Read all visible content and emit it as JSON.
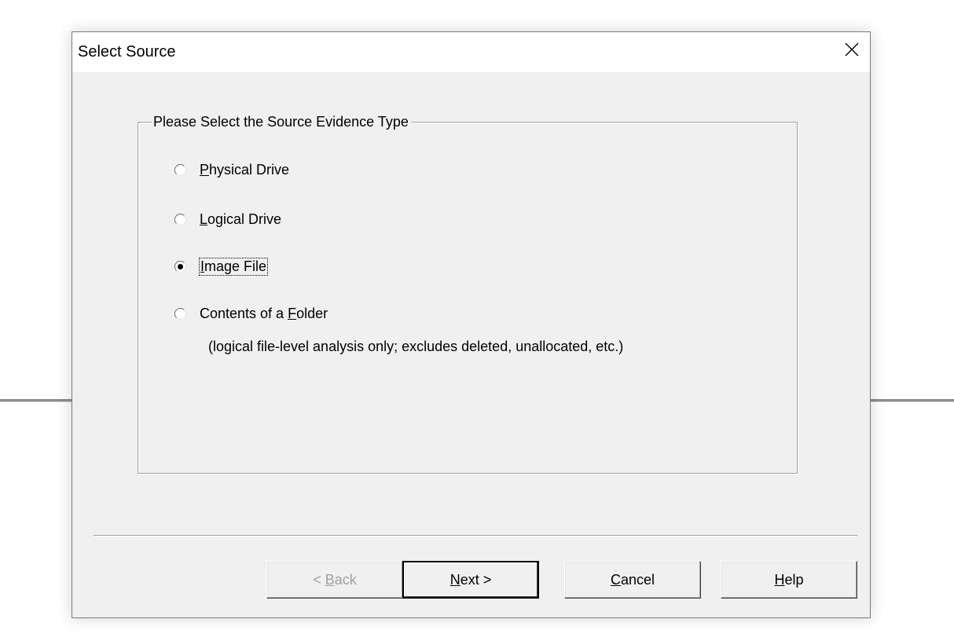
{
  "dialog": {
    "title": "Select Source",
    "close_icon": "close-icon"
  },
  "group": {
    "legend": "Please Select the Source Evidence Type",
    "options": [
      {
        "mnemonic": "P",
        "rest": "hysical Drive",
        "selected": false
      },
      {
        "mnemonic": "L",
        "rest": "ogical Drive",
        "selected": false
      },
      {
        "mnemonic": "I",
        "rest": "mage File",
        "selected": true
      },
      {
        "prefix": "Contents of a ",
        "mnemonic": "F",
        "rest": "older",
        "selected": false
      }
    ],
    "folder_note": "(logical file-level analysis only; excludes deleted, unallocated, etc.)"
  },
  "buttons": {
    "back": {
      "prefix": "< ",
      "mnemonic": "B",
      "rest": "ack",
      "enabled": false
    },
    "next": {
      "mnemonic": "N",
      "rest": "ext >",
      "default": true
    },
    "cancel": {
      "mnemonic": "C",
      "rest": "ancel"
    },
    "help": {
      "mnemonic": "H",
      "rest": "elp"
    }
  }
}
